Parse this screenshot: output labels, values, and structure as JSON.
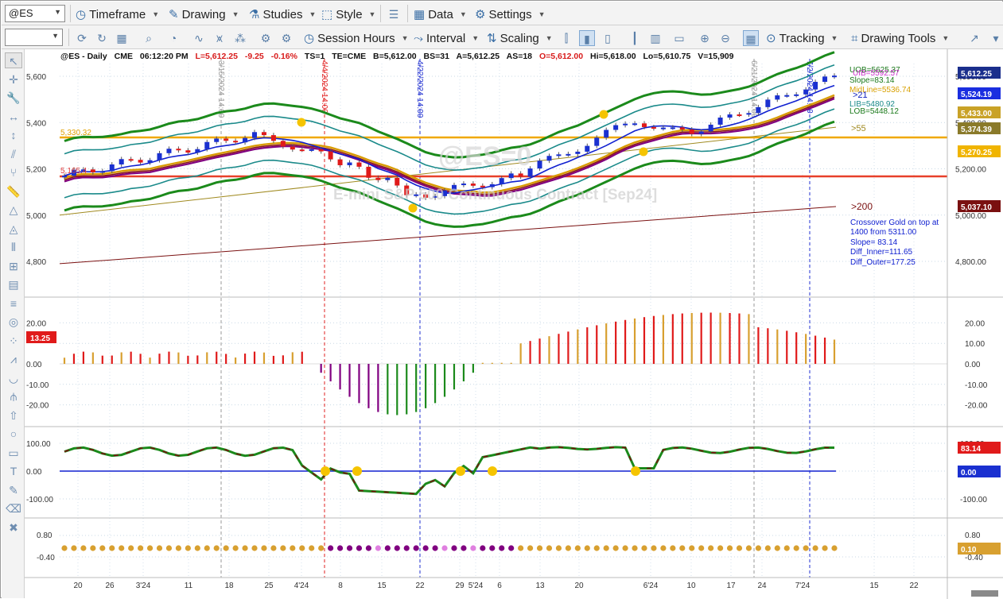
{
  "toolbar1": {
    "symbol": "@ES",
    "timeframe": "Timeframe",
    "drawing": "Drawing",
    "studies": "Studies",
    "style": "Style",
    "data": "Data",
    "settings": "Settings"
  },
  "toolbar2": {
    "session_hours": "Session Hours",
    "interval": "Interval",
    "scaling": "Scaling",
    "tracking": "Tracking",
    "drawing_tools": "Drawing Tools"
  },
  "left_tools": [
    "cursor-icon",
    "crosshair-icon",
    "wrench-icon",
    "horizontal-arrows-icon",
    "vertical-arrows-icon",
    "parallel-lines-icon",
    "fork-icon",
    "ruler-icon",
    "triangle-icon",
    "triangle-outline-icon",
    "bars-icon",
    "grid-icon",
    "table-icon",
    "lines-icon",
    "target-icon",
    "dots-icon",
    "fan-icon",
    "arc-icon",
    "pitchfork-icon",
    "arrow-up-icon",
    "circle-icon",
    "rectangle-icon",
    "text-icon",
    "pencil-icon",
    "eraser-icon",
    "delete-icon"
  ],
  "header": {
    "symbol": "@ES - Daily",
    "exchange": "CME",
    "time": "06:12:20 PM",
    "last": "L=5,612.25",
    "change": "-9.25",
    "pct": "-0.16%",
    "ts": "TS=1",
    "te": "TE=CME",
    "bid": "B=5,612.00",
    "bs": "BS=31",
    "ask": "A=5,612.25",
    "as": "AS=18",
    "open": "O=5,612.00",
    "hi": "Hi=5,618.00",
    "lo": "Lo=5,610.75",
    "vol": "V=15,909"
  },
  "watermark": {
    "symbol": "@ES=0",
    "description": "E-mini S&P 500 Continuous Contract [Sep24]"
  },
  "levels": {
    "upper": "5,330.32",
    "lower": "5,165.4"
  },
  "vlines": [
    "3/15/2024 14:00",
    "4/4/2024 14:00",
    "4/22/2024 14:00",
    "6/21/2024 14:00",
    "7/2/2024 14:00"
  ],
  "legend_top": {
    "uob": "UOB=5625.37",
    "uib": "UIB=5592.57",
    "slope": "Slope=83.14",
    "midline": "MidLine=5536.74",
    "ma21": ">21",
    "lib": "LIB=5480.92",
    "lob": "LOB=5448.12",
    "ma55": ">55",
    "ma200": ">200"
  },
  "crossover_note": [
    "Crossover Gold on top at",
    "1400 from 5311.00",
    "Slope= 83.14",
    "Diff_Inner=111.65",
    "Diff_Outer=177.25"
  ],
  "price_axis": [
    "5,600.00",
    "5,400.00",
    "5,200.00",
    "5,000.00",
    "4,800.00"
  ],
  "price_axis_left": [
    "5,600",
    "5,400",
    "5,200",
    "5,000",
    "4,800"
  ],
  "price_tags": [
    {
      "text": "5,612.25",
      "color": "#1a2e8c"
    },
    {
      "text": "5,524.19",
      "color": "#1a2ee0"
    },
    {
      "text": "5,433.00",
      "color": "#c9a227"
    },
    {
      "text": "5,374.39",
      "color": "#8a7a2a"
    },
    {
      "text": "5,270.25",
      "color": "#f0b400"
    },
    {
      "text": "5,037.10",
      "color": "#7a1010"
    }
  ],
  "osc1": {
    "axis": [
      "20.00",
      "10.00",
      "0.00",
      "-10.00",
      "-20.00"
    ],
    "axis_left": [
      "20.00",
      "0.00",
      "-10.00",
      "-20.00"
    ],
    "tag": "13.25"
  },
  "osc2": {
    "axis": [
      "100.00",
      "0.00",
      "-100.00"
    ],
    "axis_left": [
      "100.00",
      "0.00",
      "-100.00"
    ],
    "tag1": "83.14",
    "tag2": "0.00"
  },
  "osc3": {
    "axis": [
      "0.80",
      "-0.40"
    ],
    "axis_left": [
      "0.80",
      "-0.40"
    ],
    "tag": "0.10"
  },
  "x_axis": [
    "20",
    "26",
    "3'24",
    "11",
    "18",
    "25",
    "4'24",
    "8",
    "15",
    "22",
    "29",
    "5'24",
    "6",
    "13",
    "20",
    "6'24",
    "10",
    "17",
    "24",
    "7'24",
    "15",
    "22"
  ],
  "colors": {
    "gold": "#f0a800",
    "red": "#e8402a",
    "green": "#1b8a1b",
    "blue": "#1020d0",
    "maroon": "#7a1010"
  }
}
